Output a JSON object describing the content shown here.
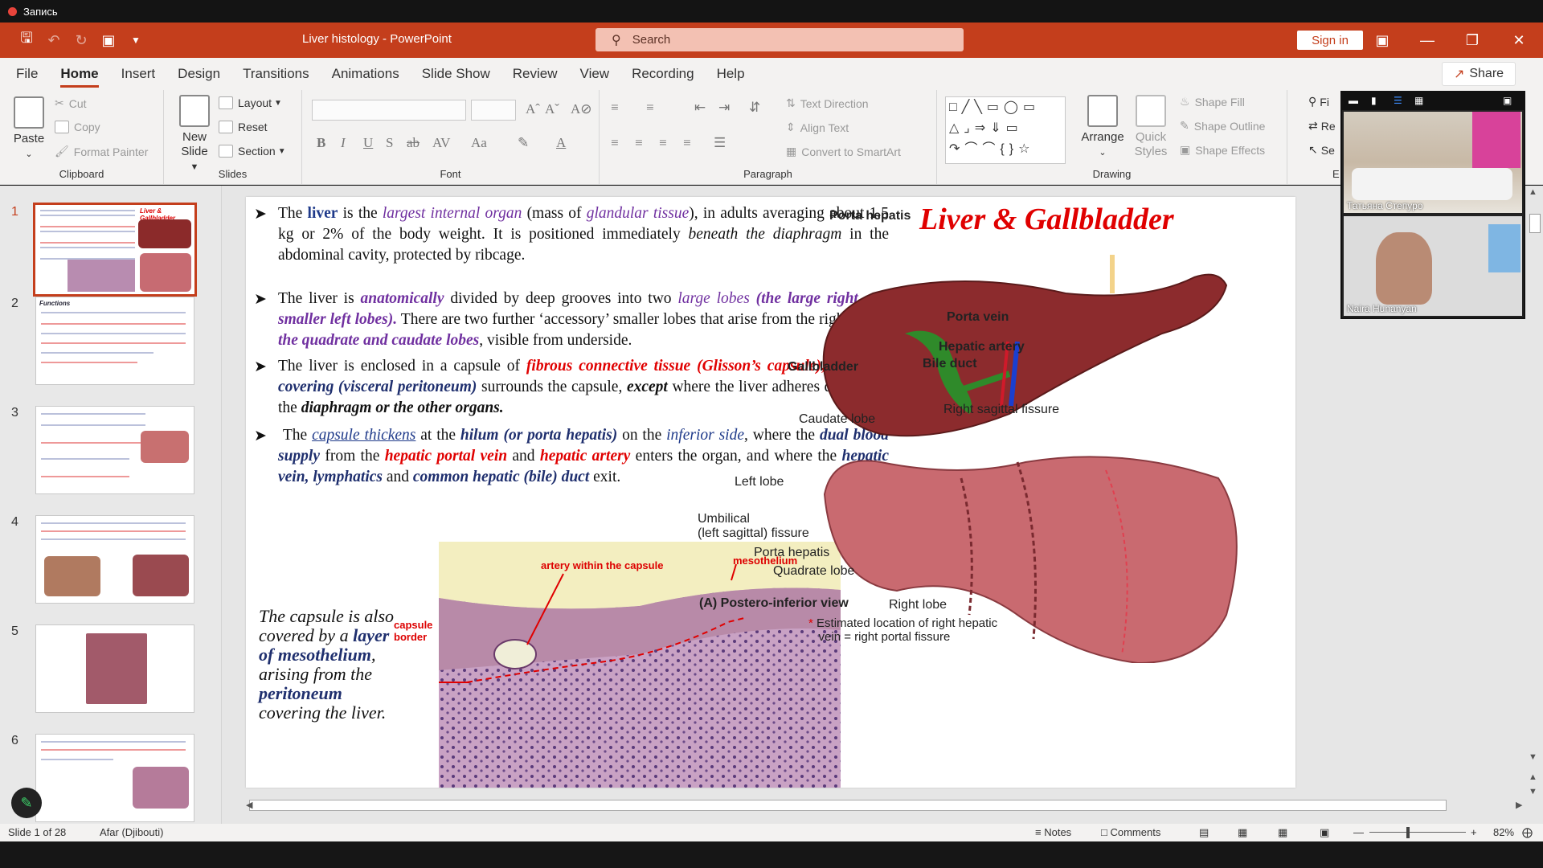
{
  "recording": {
    "label": "Запись"
  },
  "app": {
    "title": "Liver histology  -  PowerPoint",
    "search_placeholder": "Search",
    "sign_in": "Sign in",
    "share": "Share"
  },
  "menu": [
    "File",
    "Home",
    "Insert",
    "Design",
    "Transitions",
    "Animations",
    "Slide Show",
    "Review",
    "View",
    "Recording",
    "Help"
  ],
  "ribbon": {
    "clipboard": {
      "label": "Clipboard",
      "paste": "Paste",
      "cut": "Cut",
      "copy": "Copy",
      "format_painter": "Format Painter"
    },
    "slides": {
      "label": "Slides",
      "new_slide": "New",
      "new_slide2": "Slide",
      "layout": "Layout",
      "reset": "Reset",
      "section": "Section"
    },
    "font": {
      "label": "Font"
    },
    "paragraph": {
      "label": "Paragraph",
      "text_direction": "Text Direction",
      "align_text": "Align Text",
      "convert": "Convert to SmartArt"
    },
    "drawing": {
      "label": "Drawing",
      "arrange": "Arrange",
      "quick": "Quick",
      "styles": "Styles",
      "shape_fill": "Shape Fill",
      "shape_outline": "Shape Outline",
      "shape_effects": "Shape Effects"
    },
    "editing": {
      "find": "Fi",
      "replace": "Re",
      "select": "Se",
      "label": "E"
    }
  },
  "thumbs": [
    "1",
    "2",
    "3",
    "4",
    "5",
    "6"
  ],
  "slide": {
    "title": "Liver & Gallbladder",
    "side_caption": {
      "p1": "The capsule is also covered by a ",
      "layer": "layer of mesothelium",
      "p2": ", arising from the ",
      "per": "peritoneum",
      "p3": " covering the liver."
    },
    "labels": {
      "porta_hepatis": "Porta hepatis",
      "liver": "Liver",
      "porta_vein": "Porta vein",
      "hepatic_artery": "Hepatic artery",
      "bile_duct": "Bile duct",
      "gallbladder": "Gallbladder",
      "caudate": "Caudate lobe",
      "right_sagittal": "Right sagittal fissure",
      "left_lobe": "Left lobe",
      "umbilical": "Umbilical",
      "umbilical2": "(left sagittal) fissure",
      "porta_hepatis2": "Porta hepatis",
      "quadrate": "Quadrate lobe",
      "postero": "(A) Postero-inferior view",
      "right_lobe": "Right lobe",
      "estimated": "Estimated location of right hepatic",
      "estimated2": "vein = right portal fissure"
    },
    "histo": {
      "artery": "artery within the capsule",
      "meso": "mesothelium",
      "capsule": "capsule",
      "border": "border"
    }
  },
  "status": {
    "slide": "Slide 1 of 28",
    "language": "Afar (Djibouti)",
    "notes": "Notes",
    "comments": "Comments",
    "zoom": "82%"
  },
  "video": {
    "p1": "Татьяна Степуро",
    "p2": "Naira Hunanyan"
  }
}
